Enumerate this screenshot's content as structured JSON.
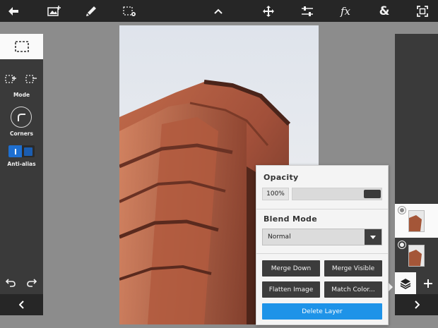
{
  "toolbar": {
    "items": [
      {
        "name": "back-icon"
      },
      {
        "name": "add-image-icon"
      },
      {
        "name": "brush-icon"
      },
      {
        "name": "selection-settings-icon"
      },
      {
        "name": "chevron-up-icon"
      },
      {
        "name": "move-icon"
      },
      {
        "name": "adjustments-icon"
      },
      {
        "name": "effects-icon",
        "label": "fx"
      },
      {
        "name": "blend-icon",
        "label": "&"
      },
      {
        "name": "fit-screen-icon"
      }
    ]
  },
  "left_panel": {
    "selection_tool": "rect-select-icon",
    "mode_label": "Mode",
    "corners_label": "Corners",
    "antialias_label": "Anti-alias",
    "antialias_on": true,
    "bottom_icon": "chevron-left-icon"
  },
  "right_panel": {
    "layers": [
      {
        "name": "layer-1",
        "selected": true
      },
      {
        "name": "layer-2",
        "selected": false
      }
    ],
    "add_icon": "plus-icon",
    "layers_icon": "layers-icon",
    "bottom_icon": "chevron-right-icon"
  },
  "layer_popup": {
    "opacity_title": "Opacity",
    "opacity_value": "100%",
    "opacity_fraction": 1.0,
    "blend_title": "Blend Mode",
    "blend_value": "Normal",
    "buttons": {
      "merge_down": "Merge Down",
      "merge_visible": "Merge Visible",
      "flatten_image": "Flatten Image",
      "match_color": "Match Color...",
      "delete_layer": "Delete Layer"
    }
  },
  "colors": {
    "background": "#8c8c8c",
    "toolbar": "#262626",
    "panel": "#3a3a3a",
    "accent_blue": "#1e93e8",
    "toggle_blue": "#1e6fd0"
  }
}
